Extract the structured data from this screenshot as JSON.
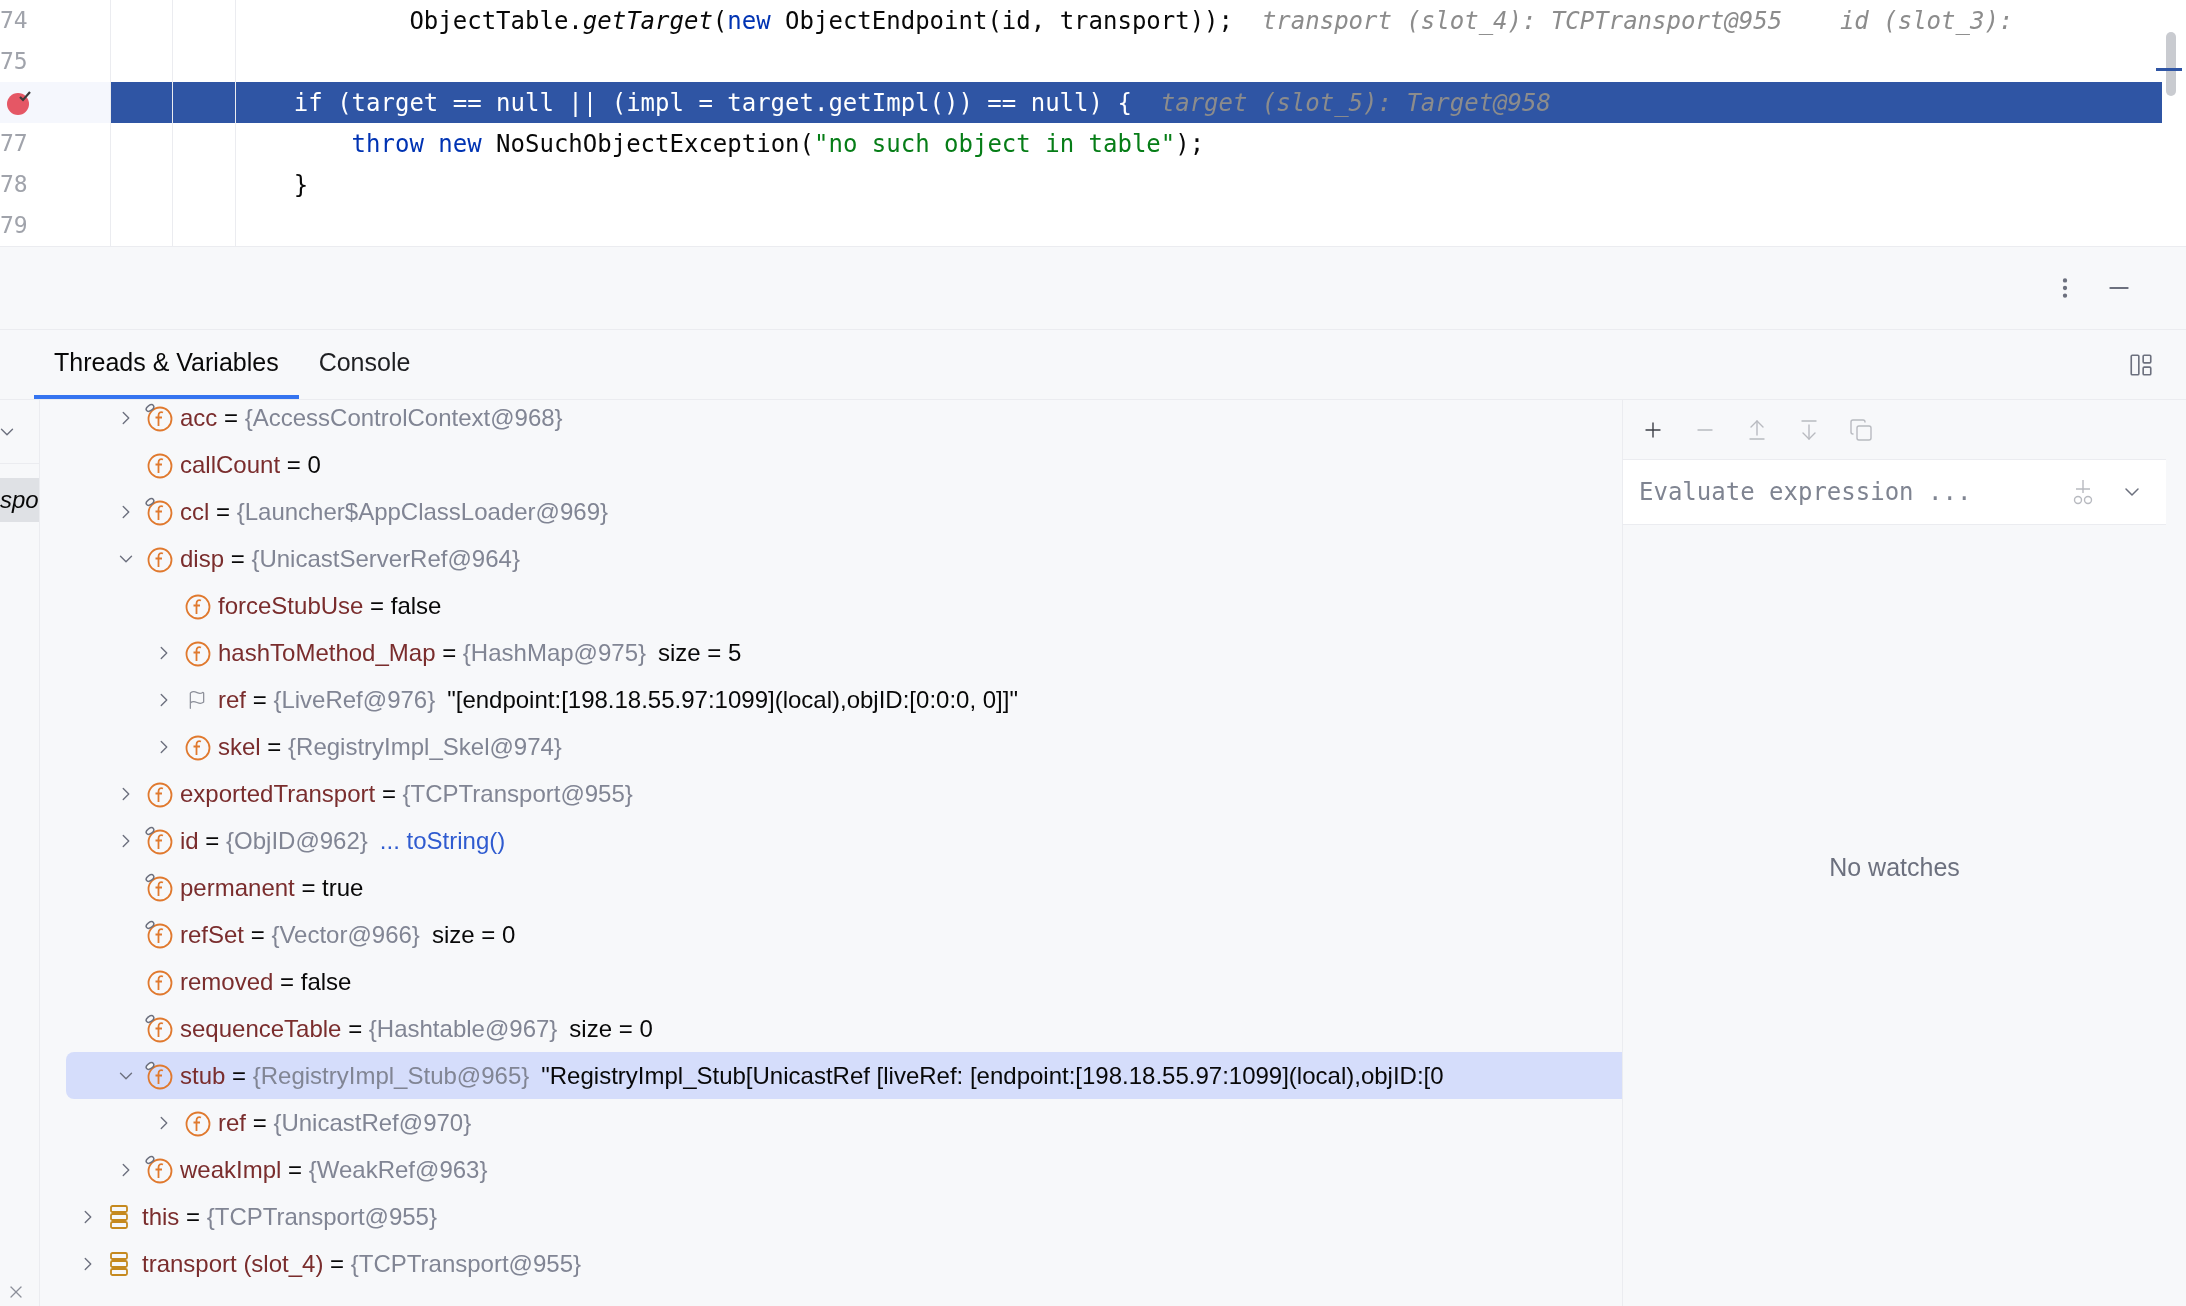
{
  "editor": {
    "lines": [
      {
        "kind": "continuation",
        "number": "74",
        "current": false,
        "breakpoint": false,
        "tokens": [
          {
            "kind": "plain",
            "text": "ObjectTable."
          },
          {
            "kind": "method",
            "text": "getTarget"
          },
          {
            "kind": "plain",
            "text": "("
          },
          {
            "kind": "keyword",
            "text": "new"
          },
          {
            "kind": "plain",
            "text": "ObjectEndpoint(id, transport));"
          }
        ],
        "hints": [
          "transport (slot_4): TCPTransport@955",
          "id (slot_3):"
        ]
      },
      {
        "kind": "blank",
        "number": "75",
        "current": false,
        "breakpoint": false
      },
      {
        "kind": "statement",
        "current": true,
        "breakpoint": true,
        "tokens": [
          {
            "kind": "plain",
            "text": "if (target == null || (impl = target.getImpl()) == null) {"
          }
        ],
        "hints": [
          "target (slot_5): Target@958"
        ]
      },
      {
        "kind": "body",
        "number": "77",
        "current": false,
        "breakpoint": false,
        "tokens": [
          {
            "kind": "keyword",
            "text": "throw"
          },
          {
            "kind": "keyword",
            "text": "new"
          },
          {
            "kind": "plain",
            "text": "NoSuchObjectException("
          },
          {
            "kind": "string",
            "text": "\"no such object in table\""
          },
          {
            "kind": "plain",
            "text": ");"
          }
        ]
      },
      {
        "kind": "statement",
        "number": "78",
        "current": false,
        "breakpoint": false,
        "tokens": [
          {
            "kind": "plain",
            "text": "}"
          }
        ]
      },
      {
        "kind": "blank",
        "number": "79",
        "current": false,
        "breakpoint": false
      }
    ]
  },
  "panel": {
    "tabs": [
      {
        "label": "Threads & Variables",
        "selected": true
      },
      {
        "label": "Console",
        "selected": false
      }
    ],
    "frames": {
      "selected_frame": "spo"
    },
    "variables": {
      "fields": [
        {
          "kind": "field_badge",
          "name": "acc",
          "op": "=",
          "has_children": true,
          "expanded": false,
          "ref": "{AccessControlContext@968}",
          "selected": false
        },
        {
          "kind": "field",
          "name": "callCount",
          "op": "=",
          "has_children": false,
          "value": "0",
          "selected": false
        },
        {
          "kind": "field_badge",
          "name": "ccl",
          "op": "=",
          "has_children": true,
          "expanded": false,
          "ref": "{Launcher$AppClassLoader@969}",
          "selected": false
        },
        {
          "kind": "field",
          "name": "disp",
          "op": "=",
          "has_children": true,
          "expanded": true,
          "ref": "{UnicastServerRef@964}",
          "selected": false,
          "children": [
            {
              "kind": "field",
              "name": "forceStubUse",
              "op": "=",
              "has_children": false,
              "value": "false",
              "selected": false
            },
            {
              "kind": "field",
              "name": "hashToMethod_Map",
              "op": "=",
              "has_children": true,
              "expanded": false,
              "ref": "{HashMap@975}",
              "extra": "size = 5",
              "selected": false
            },
            {
              "kind": "flag",
              "name": "ref",
              "op": "=",
              "has_children": true,
              "expanded": false,
              "ref": "{LiveRef@976}",
              "extra": "\"[endpoint:[198.18.55.97:1099](local),objID:[0:0:0, 0]]\"",
              "selected": false
            },
            {
              "kind": "field",
              "name": "skel",
              "op": "=",
              "has_children": true,
              "expanded": false,
              "ref": "{RegistryImpl_Skel@974}",
              "selected": false
            }
          ]
        },
        {
          "kind": "field",
          "name": "exportedTransport",
          "op": "=",
          "has_children": true,
          "expanded": false,
          "ref": "{TCPTransport@955}",
          "selected": false
        },
        {
          "kind": "field_badge",
          "name": "id",
          "op": "=",
          "has_children": true,
          "expanded": false,
          "ref": "{ObjID@962}",
          "link": "... toString()",
          "selected": false
        },
        {
          "kind": "field_badge",
          "name": "permanent",
          "op": "=",
          "has_children": false,
          "value": "true",
          "selected": false
        },
        {
          "kind": "field_badge",
          "name": "refSet",
          "op": "=",
          "has_children": false,
          "ref": "{Vector@966}",
          "extra": "size = 0",
          "selected": false
        },
        {
          "kind": "field",
          "name": "removed",
          "op": "=",
          "has_children": false,
          "value": "false",
          "selected": false
        },
        {
          "kind": "field_badge",
          "name": "sequenceTable",
          "op": "=",
          "has_children": false,
          "ref": "{Hashtable@967}",
          "extra": "size = 0",
          "selected": false
        },
        {
          "kind": "field_badge",
          "name": "stub",
          "op": "=",
          "has_children": true,
          "expanded": true,
          "ref": "{RegistryImpl_Stub@965}",
          "extra": "\"RegistryImpl_Stub[UnicastRef [liveRef: [endpoint:[198.18.55.97:1099](local),objID:[0",
          "selected": true,
          "children": [
            {
              "kind": "field",
              "name": "ref",
              "op": "=",
              "has_children": true,
              "expanded": false,
              "ref": "{UnicastRef@970}",
              "selected": false
            }
          ]
        },
        {
          "kind": "field_badge",
          "name": "weakImpl",
          "op": "=",
          "has_children": true,
          "expanded": false,
          "ref": "{WeakRef@963}",
          "selected": false
        }
      ],
      "locals": [
        {
          "kind": "local",
          "name": "this",
          "op": "=",
          "has_children": true,
          "expanded": false,
          "ref": "{TCPTransport@955}",
          "selected": false
        },
        {
          "kind": "local",
          "name": "transport (slot_4)",
          "op": "=",
          "has_children": true,
          "expanded": false,
          "ref": "{TCPTransport@955}",
          "selected": false
        }
      ]
    },
    "watches": {
      "toolbar": [
        {
          "kind": "add",
          "disabled": false
        },
        {
          "kind": "remove",
          "disabled": true
        },
        {
          "kind": "move_up",
          "disabled": true
        },
        {
          "kind": "move_down",
          "disabled": true
        },
        {
          "kind": "copy",
          "disabled": true
        }
      ],
      "placeholder": "Evaluate expression ...",
      "empty_text": "No watches"
    }
  }
}
